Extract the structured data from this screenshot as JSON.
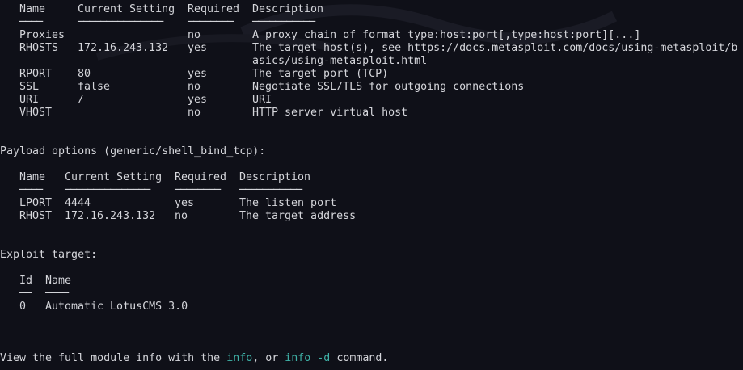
{
  "module_options": {
    "headers": [
      "Name",
      "Current Setting",
      "Required",
      "Description"
    ],
    "underlines": [
      "────",
      "───────────────",
      "────────",
      "───────────"
    ],
    "rows": [
      {
        "name": "Proxies",
        "setting": "",
        "required": "no",
        "description": "A proxy chain of format type:host:port[,type:host:port][...]"
      },
      {
        "name": "RHOSTS",
        "setting": "172.16.243.132",
        "required": "yes",
        "description": "The target host(s), see https://docs.metasploit.com/docs/using-metasploit/b",
        "description_cont": "asics/using-metasploit.html"
      },
      {
        "name": "RPORT",
        "setting": "80",
        "required": "yes",
        "description": "The target port (TCP)"
      },
      {
        "name": "SSL",
        "setting": "false",
        "required": "no",
        "description": "Negotiate SSL/TLS for outgoing connections"
      },
      {
        "name": "URI",
        "setting": "/",
        "required": "yes",
        "description": "URI"
      },
      {
        "name": "VHOST",
        "setting": "",
        "required": "no",
        "description": "HTTP server virtual host"
      }
    ]
  },
  "payload_options": {
    "title": "Payload options (generic/shell_bind_tcp):",
    "headers": [
      "Name",
      "Current Setting",
      "Required",
      "Description"
    ],
    "underlines": [
      "────",
      "───────────────",
      "────────",
      "───────────"
    ],
    "rows": [
      {
        "name": "LPORT",
        "setting": "4444",
        "required": "yes",
        "description": "The listen port"
      },
      {
        "name": "RHOST",
        "setting": "172.16.243.132",
        "required": "no",
        "description": "The target address"
      }
    ]
  },
  "exploit_target": {
    "title": "Exploit target:",
    "headers": [
      "Id",
      "Name"
    ],
    "underlines": [
      "──",
      "────"
    ],
    "rows": [
      {
        "id": "0",
        "name": "Automatic LotusCMS 3.0"
      }
    ]
  },
  "footer": {
    "prefix": "View the full module info with the ",
    "cmd1": "info",
    "middle": ", or ",
    "cmd2": "info -d",
    "suffix": " command."
  },
  "colors": {
    "background": "#0f1018",
    "text": "#d5d6db",
    "command_highlight": "#3fb3a8"
  }
}
